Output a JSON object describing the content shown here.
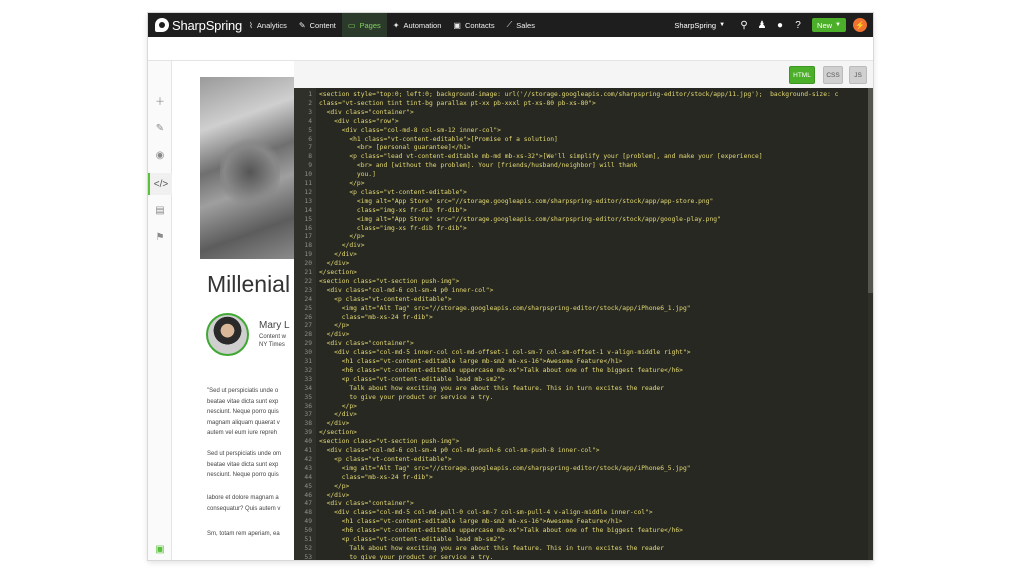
{
  "nav": {
    "brand": "SharpSpring",
    "items": [
      {
        "label": "Analytics",
        "icon": "chart-icon",
        "glyph": "⌇"
      },
      {
        "label": "Content",
        "icon": "pencil-icon",
        "glyph": "✎"
      },
      {
        "label": "Pages",
        "icon": "page-icon",
        "glyph": "▭"
      },
      {
        "label": "Automation",
        "icon": "wand-icon",
        "glyph": "✦"
      },
      {
        "label": "Contacts",
        "icon": "contact-card-icon",
        "glyph": "▣"
      },
      {
        "label": "Sales",
        "icon": "trend-icon",
        "glyph": "⟋"
      }
    ],
    "active": "Pages",
    "account": "SharpSpring",
    "new_label": "New",
    "accent": "#4caf2a"
  },
  "editor": {
    "tabs": {
      "html": "HTML",
      "css": "CSS",
      "js": "JS"
    },
    "lines": [
      {
        "n": "1",
        "code": "<section style=\"top:0; left:0; background-image: url('//storage.googleapis.com/sharpspring-editor/stock/app/11.jpg');  background-size: c"
      },
      {
        "n": "2",
        "code": "class=\"vt-section tint tint-bg parallax pt-xx pb-xxxl pt-xs-80 pb-xs-80\">"
      },
      {
        "n": "3",
        "code": "  <div class=\"container\">"
      },
      {
        "n": "4",
        "code": "    <div class=\"row\">"
      },
      {
        "n": "5",
        "code": "      <div class=\"col-md-8 col-sm-12 inner-col\">"
      },
      {
        "n": "6",
        "code": "        <h1 class=\"vt-content-editable\">[Promise of a solution]"
      },
      {
        "n": "7",
        "code": "          <br> [personal guarantee]</h1>"
      },
      {
        "n": "8",
        "code": "        <p class=\"lead vt-content-editable mb-md mb-xs-32\">[We'll simplify your [problem], and make your [experience]"
      },
      {
        "n": "9",
        "code": "          <br> and [without the problem]. Your [friends/husband/neighbor] will thank"
      },
      {
        "n": "10",
        "code": "          you.]"
      },
      {
        "n": "11",
        "code": "        </p>"
      },
      {
        "n": "12",
        "code": "        <p class=\"vt-content-editable\">"
      },
      {
        "n": "13",
        "code": "          <img alt=\"App Store\" src=\"//storage.googleapis.com/sharpspring-editor/stock/app/app-store.png\""
      },
      {
        "n": "14",
        "code": "          class=\"img-xs fr-dib fr-dib\">"
      },
      {
        "n": "15",
        "code": "          <img alt=\"App Store\" src=\"//storage.googleapis.com/sharpspring-editor/stock/app/google-play.png\""
      },
      {
        "n": "16",
        "code": "          class=\"img-xs fr-dib fr-dib\">"
      },
      {
        "n": "17",
        "code": "        </p>"
      },
      {
        "n": "18",
        "code": "      </div>"
      },
      {
        "n": "19",
        "code": "    </div>"
      },
      {
        "n": "20",
        "code": "  </div>"
      },
      {
        "n": "21",
        "code": "</section>"
      },
      {
        "n": "22",
        "code": "<section class=\"vt-section push-img\">"
      },
      {
        "n": "23",
        "code": "  <div class=\"col-md-6 col-sm-4 p0 inner-col\">"
      },
      {
        "n": "24",
        "code": "    <p class=\"vt-content-editable\">"
      },
      {
        "n": "25",
        "code": "      <img alt=\"Alt Tag\" src=\"//storage.googleapis.com/sharpspring-editor/stock/app/iPhone6_1.jpg\""
      },
      {
        "n": "26",
        "code": "      class=\"mb-xs-24 fr-dib\">"
      },
      {
        "n": "27",
        "code": "    </p>"
      },
      {
        "n": "28",
        "code": "  </div>"
      },
      {
        "n": "29",
        "code": "  <div class=\"container\">"
      },
      {
        "n": "30",
        "code": "    <div class=\"col-md-5 inner-col col-md-offset-1 col-sm-7 col-sm-offset-1 v-align-middle right\">"
      },
      {
        "n": "31",
        "code": "      <h1 class=\"vt-content-editable large mb-sm2 mb-xs-16\">Awesome Feature</h1>"
      },
      {
        "n": "32",
        "code": "      <h6 class=\"vt-content-editable uppercase mb-xs\">Talk about one of the biggest feature</h6>"
      },
      {
        "n": "33",
        "code": "      <p class=\"vt-content-editable lead mb-sm2\">"
      },
      {
        "n": "34",
        "code": "        Talk about how exciting you are about this feature. This in turn excites the reader"
      },
      {
        "n": "35",
        "code": "        to give your product or service a try."
      },
      {
        "n": "36",
        "code": "      </p>"
      },
      {
        "n": "37",
        "code": "    </div>"
      },
      {
        "n": "38",
        "code": "  </div>"
      },
      {
        "n": "39",
        "code": "</section>"
      },
      {
        "n": "40",
        "code": "<section class=\"vt-section push-img\">"
      },
      {
        "n": "41",
        "code": "  <div class=\"col-md-6 col-sm-4 p0 col-md-push-6 col-sm-push-8 inner-col\">"
      },
      {
        "n": "42",
        "code": "    <p class=\"vt-content-editable\">"
      },
      {
        "n": "43",
        "code": "      <img alt=\"Alt Tag\" src=\"//storage.googleapis.com/sharpspring-editor/stock/app/iPhone6_5.jpg\""
      },
      {
        "n": "44",
        "code": "      class=\"mb-xs-24 fr-dib\">"
      },
      {
        "n": "45",
        "code": "    </p>"
      },
      {
        "n": "46",
        "code": "  </div>"
      },
      {
        "n": "47",
        "code": "  <div class=\"container\">"
      },
      {
        "n": "48",
        "code": "    <div class=\"col-md-5 col-md-pull-0 col-sm-7 col-sm-pull-4 v-align-middle inner-col\">"
      },
      {
        "n": "49",
        "code": "      <h1 class=\"vt-content-editable large mb-sm2 mb-xs-16\">Awesome Feature</h1>"
      },
      {
        "n": "50",
        "code": "      <h6 class=\"vt-content-editable uppercase mb-xs\">Talk about one of the biggest feature</h6>"
      },
      {
        "n": "51",
        "code": "      <p class=\"vt-content-editable lead mb-sm2\">"
      },
      {
        "n": "52",
        "code": "        Talk about how exciting you are about this feature. This in turn excites the reader"
      },
      {
        "n": "53",
        "code": "        to give your product or service a try."
      }
    ]
  },
  "preview": {
    "title": "Millenial",
    "author_name": "Mary L",
    "author_line1": "Content w",
    "author_line2": "NY Times",
    "paragraphs": [
      "\"Sed ut perspiciatis unde o",
      "beatae vitae dicta sunt exp",
      "nesciunt. Neque porro quis",
      "magnam aliquam quaerat v",
      "autem vel eum iure repreh",
      "",
      "Sed ut perspiciatis unde om",
      "beatae vitae dicta sunt exp",
      "nesciunt. Neque porro quis",
      "",
      "labore et dolore magnam a",
      "consequatur? Quis autem v",
      "",
      "Sm, totam rem aperiam, ea"
    ]
  }
}
